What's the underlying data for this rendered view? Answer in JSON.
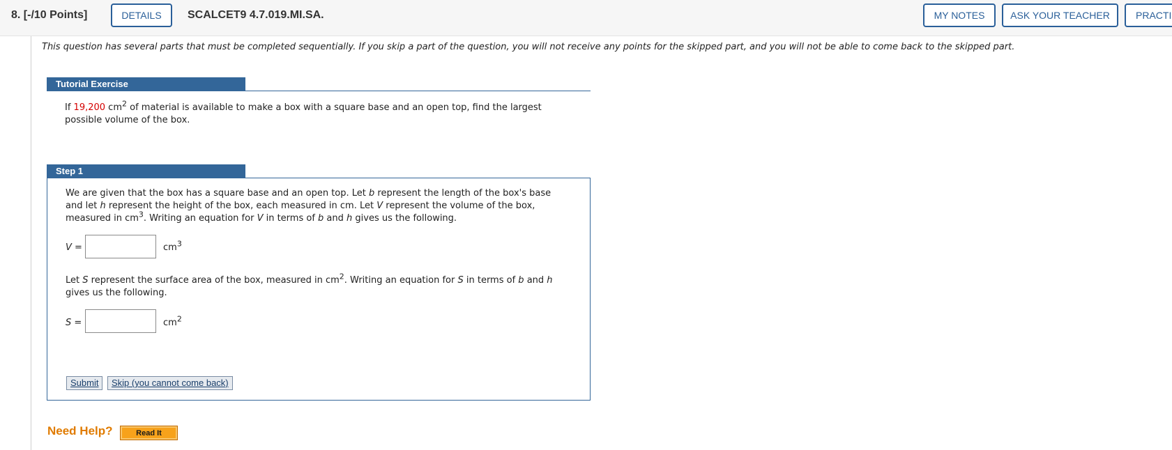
{
  "header": {
    "question_number": "8. [-/10 Points]",
    "details_label": "DETAILS",
    "question_code": "SCALCET9 4.7.019.MI.SA.",
    "my_notes_label": "MY NOTES",
    "ask_teacher_label": "ASK YOUR TEACHER",
    "practice_label": "PRACTICE ANOTHER"
  },
  "instructions": "This question has several parts that must be completed sequentially. If you skip a part of the question, you will not receive any points for the skipped part, and you will not be able to come back to the skipped part.",
  "tutorial": {
    "tab_label": "Tutorial Exercise",
    "problem_prefix": "If ",
    "problem_value": "19,200",
    "problem_unit": " cm",
    "problem_exp": "2",
    "problem_suffix": " of material is available to make a box with a square base and an open top, find the largest possible volume of the box."
  },
  "step1": {
    "tab_label": "Step 1",
    "para1_a": "We are given that the box has a square base and an open top. Let ",
    "para1_b_var": "b",
    "para1_c": " represent the length of the box's base and let ",
    "para1_d_var": "h",
    "para1_e": " represent the height of the box, each measured in cm. Let ",
    "para1_f_var": "V",
    "para1_g": " represent the volume of the box, measured in cm",
    "para1_h_exp": "3",
    "para1_i": ". Writing an equation for ",
    "para1_j_var": "V",
    "para1_k": " in terms of ",
    "para1_l_var": "b",
    "para1_m": " and ",
    "para1_n_var": "h",
    "para1_o": " gives us the following.",
    "v_var": "V",
    "v_eq": " =",
    "v_value": "",
    "v_unit": "cm",
    "v_unit_exp": "3",
    "para2_a": "Let ",
    "para2_b_var": "S",
    "para2_c": " represent the surface area of the box, measured in cm",
    "para2_d_exp": "2",
    "para2_e": ". Writing an equation for ",
    "para2_f_var": "S",
    "para2_g": " in terms of ",
    "para2_h_var": "b",
    "para2_i": " and ",
    "para2_j_var": "h",
    "para2_k": " gives us the following.",
    "s_var": "S",
    "s_eq": " =",
    "s_value": "",
    "s_unit": "cm",
    "s_unit_exp": "2",
    "submit_label": "Submit",
    "skip_label": "Skip (you cannot come back)"
  },
  "help": {
    "need_help_label": "Need Help?",
    "read_it_label": "Read It"
  },
  "colors": {
    "accent_blue": "#336699",
    "highlight_red": "#d50000",
    "help_orange": "#e07b00"
  }
}
